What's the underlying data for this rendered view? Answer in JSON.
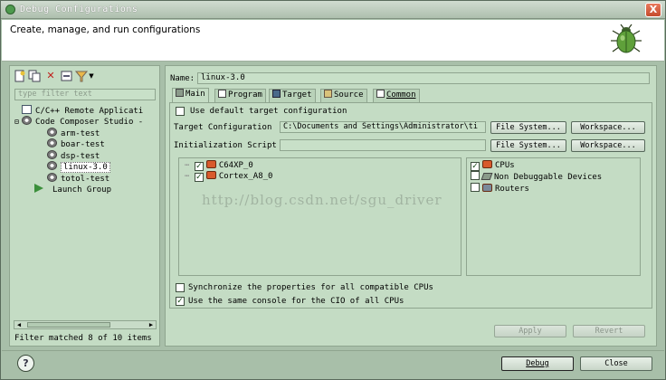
{
  "window": {
    "title": "Debug Configurations",
    "close_label": "X",
    "heading": "Create, manage, and run configurations"
  },
  "left": {
    "toolbar_icons": [
      "new-config-icon",
      "duplicate-icon",
      "delete-icon",
      "collapse-all-icon",
      "filter-icon",
      "menu-dropdown-icon"
    ],
    "filter_placeholder": "type filter text",
    "tree": [
      {
        "label": "C/C++ Remote Applicati",
        "icon": "c-app-icon",
        "level": 0
      },
      {
        "label": "Code Composer Studio -",
        "icon": "ccs-icon",
        "level": 0,
        "expanded": true
      },
      {
        "label": "arm-test",
        "icon": "ccs-config-icon",
        "level": 1
      },
      {
        "label": "boar-test",
        "icon": "ccs-config-icon",
        "level": 1
      },
      {
        "label": "dsp-test",
        "icon": "ccs-config-icon",
        "level": 1
      },
      {
        "label": "linux-3.0",
        "icon": "ccs-config-icon",
        "level": 1,
        "selected": true
      },
      {
        "label": "totol-test",
        "icon": "ccs-config-icon",
        "level": 1
      },
      {
        "label": "Launch Group",
        "icon": "launch-group-icon",
        "level": 0
      }
    ],
    "status": "Filter matched 8 of 10 items"
  },
  "right": {
    "name_label": "Name:",
    "name_value": "linux-3.0",
    "tabs": [
      {
        "label": "Main",
        "active": true
      },
      {
        "label": "Program",
        "active": false
      },
      {
        "label": "Target",
        "active": false
      },
      {
        "label": "Source",
        "active": false
      },
      {
        "label": "Common",
        "active": false
      }
    ],
    "use_default_label": "Use default target configuration",
    "use_default_checked": false,
    "target_config_label": "Target Configuration",
    "target_config_value": "C:\\Documents and Settings\\Administrator\\ti",
    "init_script_label": "Initialization Script",
    "init_script_value": "",
    "file_system_label": "File System...",
    "workspace_label": "Workspace...",
    "cores": [
      {
        "label": "C64XP_0",
        "checked": true
      },
      {
        "label": "Cortex_A8_0",
        "checked": true
      }
    ],
    "filters": [
      {
        "label": "CPUs",
        "checked": true
      },
      {
        "label": "Non Debuggable Devices",
        "checked": false
      },
      {
        "label": "Routers",
        "checked": false
      }
    ],
    "watermark": "http://blog.csdn.net/sgu_driver",
    "sync_label": "Synchronize the properties for all compatible CPUs",
    "sync_checked": false,
    "same_console_label": "Use the same console for the CIO of all CPUs",
    "same_console_checked": true,
    "apply_label": "Apply",
    "revert_label": "Revert"
  },
  "footer": {
    "help_label": "?",
    "debug_label": "Debug",
    "close_label": "Close"
  },
  "colors": {
    "background": "#a8bfa9",
    "panel": "#c4dcc4",
    "accent_red": "#d85a2c"
  }
}
